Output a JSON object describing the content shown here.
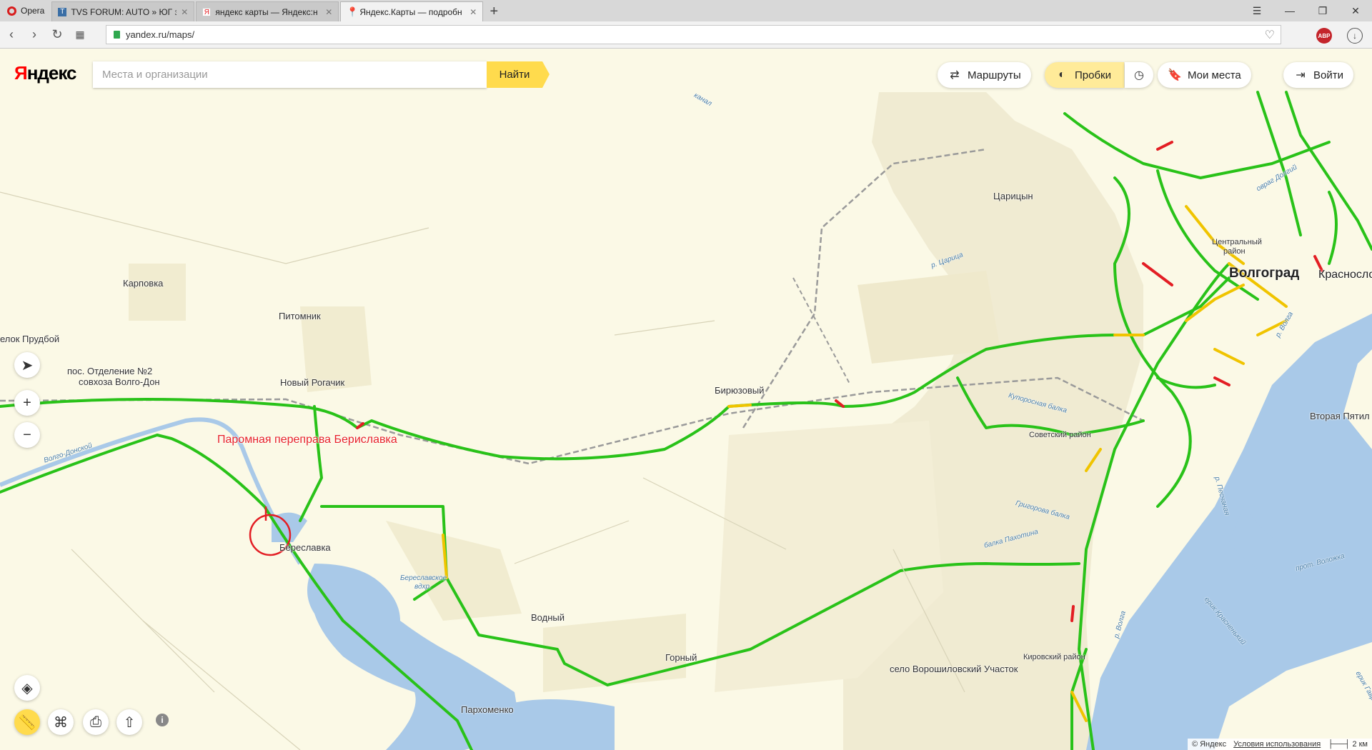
{
  "browser": {
    "opera_label": "Opera",
    "tabs": [
      {
        "label": "TVS FORUM: AUTO » ЮГ з",
        "favicon": "forum"
      },
      {
        "label": "яндекс карты — Яндекс:н",
        "favicon": "yandex"
      },
      {
        "label": "Яндекс.Карты — подробн",
        "favicon": "map-pin",
        "active": true
      }
    ],
    "url": "yandex.ru/maps/",
    "abp_label": "ABP"
  },
  "map": {
    "logo": "Яндекс",
    "search_placeholder": "Места и организации",
    "find_label": "Найти",
    "controls": {
      "routes": "Маршруты",
      "traffic": "Пробки",
      "my_places": "Мои места",
      "login": "Войти"
    },
    "labels": {
      "karpovka": "Карповка",
      "pitomnik": "Питомник",
      "prudboy": "елок Прудбой",
      "otdelenie": "пос. Отделение №2",
      "sovhoz": "совхоза Волго-Дон",
      "novy_rogachik": "Новый Рогачик",
      "ferry": "Паромная переправа Бериславка",
      "bereslavka": "Береславка",
      "vodny": "Водный",
      "gorny": "Горный",
      "parhomenko": "Пархоменко",
      "biryuzovy": "Бирюзовый",
      "tsaritsyn": "Царицын",
      "volgograd": "Волгоград",
      "krasnosl": "Краснослобо",
      "central": "Центральный",
      "rayon": "район",
      "sovetsky": "Советский район",
      "kirovsky": "Кировский район",
      "voroshilovsky": "село Ворошиловский Участок",
      "vtoraya": "Вторая Пятил",
      "bereslavskoe": "Береславское",
      "vdhr": "вдхр.",
      "r_tsaritsa": "р. Царица",
      "r_volga1": "р. Волга",
      "r_volga2": "р. Волга",
      "kuporosnaya": "Купоросная балка",
      "grigorova": "Григорова балка",
      "pahotina": "балка Пахотина",
      "prot_volozhka": "прот. Воложка",
      "erik_krasnenkiy": "ерик Красненький",
      "erik_gavrilov": "ерик Гавриловка",
      "ovrag_dolgiy": "овраг Долгий",
      "kanal": "канал",
      "volgo_don": "Волго-Донской",
      "r_peschanaya": "р. Песчаная"
    },
    "copyright": "© Яндекс",
    "terms": "Условия использования",
    "scale": "2 км"
  },
  "colors": {
    "traffic_green": "#29c219",
    "traffic_yellow": "#f0c400",
    "traffic_red": "#e31e24",
    "water": "#a9c9e8",
    "park": "#f2efd2",
    "brand_yellow": "#ffdb4d"
  }
}
